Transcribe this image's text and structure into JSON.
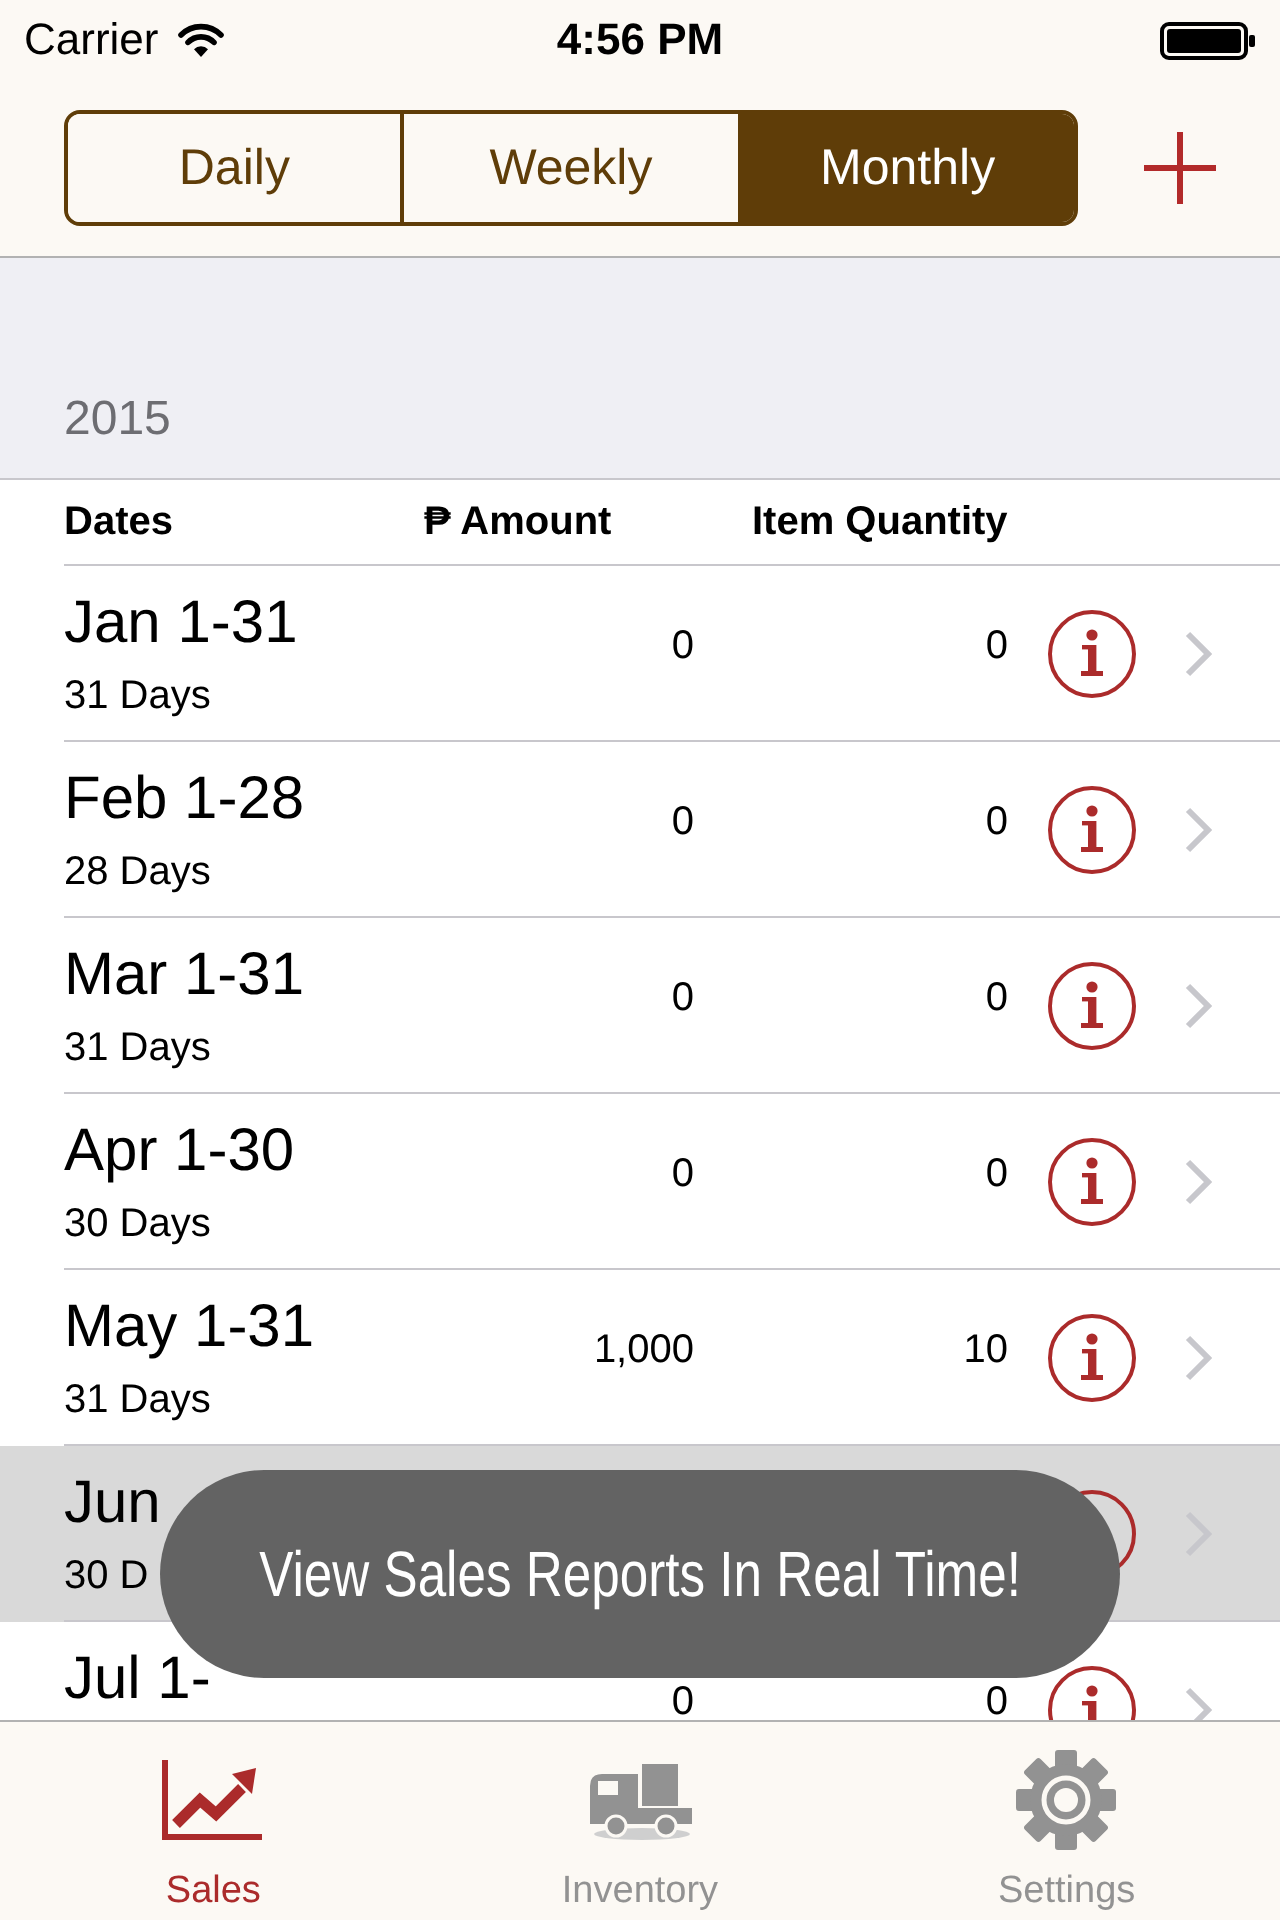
{
  "status_bar": {
    "carrier": "Carrier",
    "time": "4:56 PM"
  },
  "segments": [
    {
      "label": "Daily",
      "selected": false
    },
    {
      "label": "Weekly",
      "selected": false
    },
    {
      "label": "Monthly",
      "selected": true
    }
  ],
  "section": {
    "title": "2015"
  },
  "table": {
    "columns": [
      "Dates",
      "₱ Amount",
      "Item Quantity"
    ],
    "rows": [
      {
        "date": "Jan 1-31",
        "days": "31 Days",
        "amount": "0",
        "quantity": "0",
        "selected": false
      },
      {
        "date": "Feb 1-28",
        "days": "28 Days",
        "amount": "0",
        "quantity": "0",
        "selected": false
      },
      {
        "date": "Mar 1-31",
        "days": "31 Days",
        "amount": "0",
        "quantity": "0",
        "selected": false
      },
      {
        "date": "Apr 1-30",
        "days": "30 Days",
        "amount": "0",
        "quantity": "0",
        "selected": false
      },
      {
        "date": "May 1-31",
        "days": "31 Days",
        "amount": "1,000",
        "quantity": "10",
        "selected": false
      },
      {
        "date": "Jun",
        "days": "30 D",
        "selected": true
      },
      {
        "date": "Jul 1-",
        "amount": "0",
        "quantity": "0",
        "selected": false
      }
    ]
  },
  "toast": {
    "text": "View Sales Reports In Real Time!"
  },
  "tab_bar": [
    {
      "label": "Sales",
      "selected": true,
      "kind": "chart"
    },
    {
      "label": "Inventory",
      "selected": false,
      "kind": "truck"
    },
    {
      "label": "Settings",
      "selected": false,
      "kind": "gear"
    }
  ]
}
